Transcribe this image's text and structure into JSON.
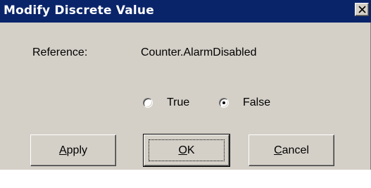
{
  "window": {
    "title": "Modify Discrete Value",
    "close_label": "X"
  },
  "reference": {
    "label": "Reference:",
    "value": "Counter.AlarmDisabled"
  },
  "options": {
    "true_label": "True",
    "false_label": "False",
    "selected": "False"
  },
  "buttons": {
    "apply": {
      "accel": "A",
      "rest": "pply"
    },
    "ok": {
      "accel": "O",
      "rest": "K"
    },
    "cancel": {
      "accel": "C",
      "rest": "ancel"
    }
  },
  "colors": {
    "titlebar": "#0a246a",
    "face": "#d4d0c8"
  },
  "icons": {
    "close": "close-icon"
  }
}
